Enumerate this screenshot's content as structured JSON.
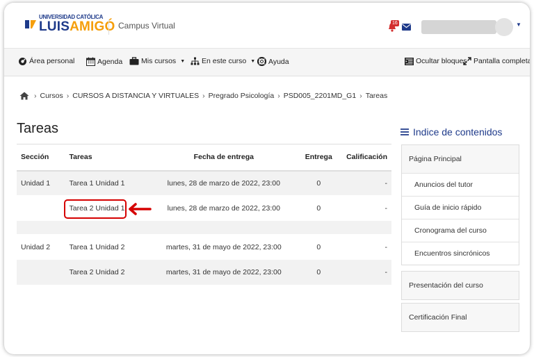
{
  "header": {
    "logo_line1": "UNIVERSIDAD CATÓLICA",
    "logo_luis": "LUIS",
    "logo_amigo": "AMIGÓ",
    "site_name": "Campus Virtual",
    "notification_count": "16"
  },
  "nav": {
    "items": [
      {
        "label": "Área personal",
        "icon": "dashboard-icon"
      },
      {
        "label": "Agenda",
        "icon": "calendar-icon"
      },
      {
        "label": "Mis cursos",
        "icon": "briefcase-icon"
      },
      {
        "label": "En este curso",
        "icon": "sitemap-icon"
      },
      {
        "label": "Ayuda",
        "icon": "lifebuoy-icon"
      }
    ],
    "right": [
      {
        "label": "Ocultar bloques",
        "icon": "collapse-blocks-icon"
      },
      {
        "label": "Pantalla completa",
        "icon": "fullscreen-icon"
      }
    ]
  },
  "breadcrumb": [
    "Cursos",
    "CURSOS A DISTANCIA Y VIRTUALES",
    "Pregrado Psicología",
    "PSD005_2201MD_G1",
    "Tareas"
  ],
  "page": {
    "title": "Tareas"
  },
  "table": {
    "headers": [
      "Sección",
      "Tareas",
      "Fecha de entrega",
      "Entrega",
      "Calificación"
    ],
    "rows": [
      {
        "section": "Unidad 1",
        "task": "Tarea 1 Unidad 1",
        "due": "lunes, 28 de marzo de 2022, 23:00",
        "submissions": "0",
        "grade": "-"
      },
      {
        "section": "",
        "task": "Tarea 2 Unidad 1",
        "due": "lunes, 28 de marzo de 2022, 23:00",
        "submissions": "0",
        "grade": "-"
      },
      {
        "section": "Unidad 2",
        "task": "Tarea 1 Unidad 2",
        "due": "martes, 31 de mayo de 2022, 23:00",
        "submissions": "0",
        "grade": "-"
      },
      {
        "section": "",
        "task": "Tarea 2 Unidad 2",
        "due": "martes, 31 de mayo de 2022, 23:00",
        "submissions": "0",
        "grade": "-"
      }
    ]
  },
  "sidebar": {
    "title": "Indice de contenidos",
    "main": "Página Principal",
    "sub_items": [
      "Anuncios del tutor",
      "Guía de inicio rápido",
      "Cronograma del curso",
      "Encuentros sincrónicos"
    ],
    "sections": [
      "Presentación del curso",
      "Certificación Final"
    ]
  },
  "colors": {
    "brand_blue": "#1e3a8a",
    "brand_orange": "#f59e0b",
    "highlight_red": "#d50000"
  }
}
